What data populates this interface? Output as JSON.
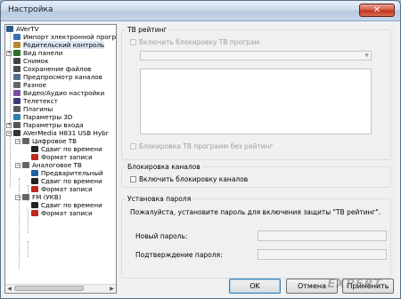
{
  "window": {
    "title": "Настройка",
    "close_glyph": "✕"
  },
  "tree": {
    "items": [
      {
        "label": "AVerTV",
        "icon": "app-icon",
        "color": "#2f5c8f"
      },
      {
        "label": "Импорт электронной прогр",
        "icon": "epg-icon",
        "color": "#3a6fb0"
      },
      {
        "label": "Родительский контроль",
        "icon": "parental-lock-icon",
        "color": "#b58a2a"
      },
      {
        "label": "Вид панели",
        "icon": "panel-view-icon",
        "color": "#2b6f2b"
      },
      {
        "label": "Снимок",
        "icon": "snapshot-icon",
        "color": "#444444"
      },
      {
        "label": "Сохранение файлов",
        "icon": "file-save-icon",
        "color": "#4a4a4a"
      },
      {
        "label": "Предпросмотр каналов",
        "icon": "preview-icon",
        "color": "#556b8f"
      },
      {
        "label": "Разное",
        "icon": "misc-icon",
        "color": "#666666"
      },
      {
        "label": "Видео/Аудио настройки",
        "icon": "video-audio-icon",
        "color": "#7a4fa0"
      },
      {
        "label": "Телетекст",
        "icon": "teletext-icon",
        "color": "#3b3b7a"
      },
      {
        "label": "Плагины",
        "icon": "plugins-icon",
        "color": "#5c5c5c"
      },
      {
        "label": "Параметры 3D",
        "icon": "3d-icon",
        "color": "#2f7fa8"
      },
      {
        "label": "Параметры входа",
        "icon": "input-icon",
        "color": "#555555"
      },
      {
        "label": "AVerMedia H831 USB Hybr",
        "icon": "device-icon",
        "color": "#333333"
      },
      {
        "label": "Цифровое ТВ",
        "icon": "tv-icon",
        "color": "#666666"
      },
      {
        "label": "Сдвиг по времени",
        "icon": "timeshift-icon",
        "color": "#222222"
      },
      {
        "label": "Формат записи",
        "icon": "record-format-icon",
        "color": "#c0281f"
      },
      {
        "label": "Аналоговое ТВ",
        "icon": "tv-icon",
        "color": "#666666"
      },
      {
        "label": "Предварительный",
        "icon": "check-icon",
        "color": "#1f5fa0"
      },
      {
        "label": "Сдвиг по времени",
        "icon": "timeshift-icon",
        "color": "#222222"
      },
      {
        "label": "Формат записи",
        "icon": "record-format-icon",
        "color": "#c0281f"
      },
      {
        "label": "FM (УКВ)",
        "icon": "radio-icon",
        "color": "#666666"
      },
      {
        "label": "Сдвиг по времени",
        "icon": "timeshift-icon",
        "color": "#222222"
      },
      {
        "label": "Формат записи",
        "icon": "record-format-icon",
        "color": "#c0281f"
      }
    ]
  },
  "tv_rating": {
    "title": "ТВ рейтинг",
    "enable_block_label": "Включить блокировку ТВ програм",
    "combo_value": "",
    "block_unrated_label": "Блокировка ТВ программ без рейтинг"
  },
  "channel_block": {
    "title": "Блокировка каналов",
    "enable_label": "Включить блокировку каналов"
  },
  "password": {
    "title": "Установка пароля",
    "hint": "Пожалуйста, установите пароль для включения защиты \"ТВ рейтинг\".",
    "new_label": "Новый пароль:",
    "confirm_label": "Подтверждение пароля:",
    "new_value": "",
    "confirm_value": ""
  },
  "buttons": {
    "ok": "OK",
    "cancel": "Отмена",
    "apply": "Применить"
  },
  "watermark": "EXPERT"
}
